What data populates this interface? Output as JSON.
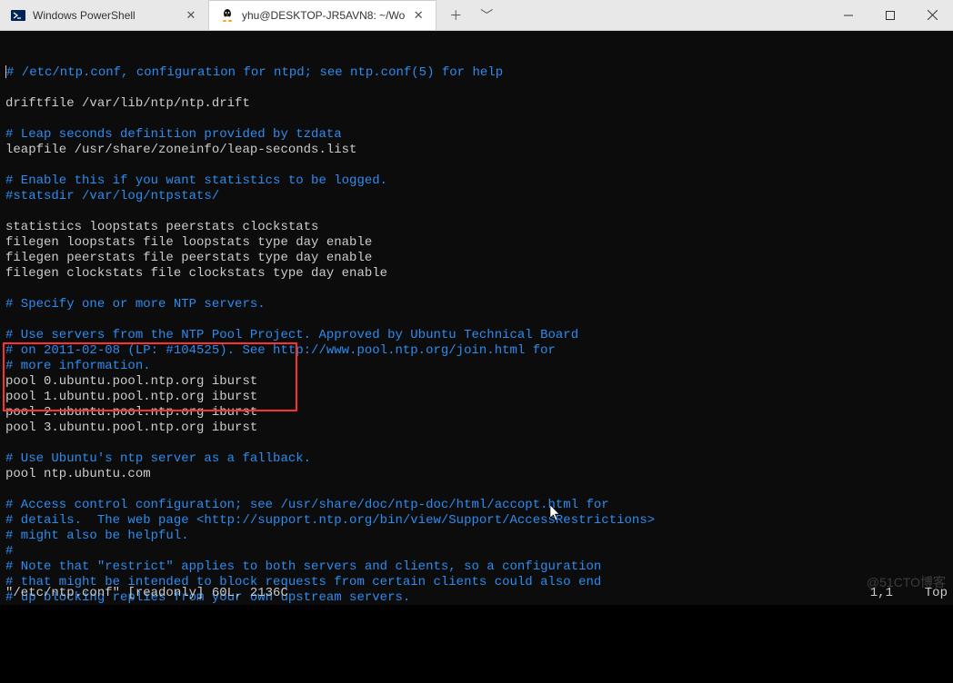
{
  "tabs": [
    {
      "title": "Windows PowerShell",
      "icon": "powershell"
    },
    {
      "title": "yhu@DESKTOP-JR5AVN8: ~/Wo",
      "icon": "tux"
    }
  ],
  "lines": [
    {
      "cls": "comment",
      "text": "# /etc/ntp.conf, configuration for ntpd; see ntp.conf(5) for help"
    },
    {
      "cls": "plain",
      "text": ""
    },
    {
      "cls": "plain",
      "text": "driftfile /var/lib/ntp/ntp.drift"
    },
    {
      "cls": "plain",
      "text": ""
    },
    {
      "cls": "comment",
      "text": "# Leap seconds definition provided by tzdata"
    },
    {
      "cls": "plain",
      "text": "leapfile /usr/share/zoneinfo/leap-seconds.list"
    },
    {
      "cls": "plain",
      "text": ""
    },
    {
      "cls": "comment",
      "text": "# Enable this if you want statistics to be logged."
    },
    {
      "cls": "comment",
      "text": "#statsdir /var/log/ntpstats/"
    },
    {
      "cls": "plain",
      "text": ""
    },
    {
      "cls": "plain",
      "text": "statistics loopstats peerstats clockstats"
    },
    {
      "cls": "plain",
      "text": "filegen loopstats file loopstats type day enable"
    },
    {
      "cls": "plain",
      "text": "filegen peerstats file peerstats type day enable"
    },
    {
      "cls": "plain",
      "text": "filegen clockstats file clockstats type day enable"
    },
    {
      "cls": "plain",
      "text": ""
    },
    {
      "cls": "comment",
      "text": "# Specify one or more NTP servers."
    },
    {
      "cls": "plain",
      "text": ""
    },
    {
      "cls": "comment",
      "text": "# Use servers from the NTP Pool Project. Approved by Ubuntu Technical Board"
    },
    {
      "cls": "comment",
      "text": "# on 2011-02-08 (LP: #104525). See http://www.pool.ntp.org/join.html for"
    },
    {
      "cls": "comment",
      "text": "# more information."
    },
    {
      "cls": "plain",
      "text": "pool 0.ubuntu.pool.ntp.org iburst"
    },
    {
      "cls": "plain",
      "text": "pool 1.ubuntu.pool.ntp.org iburst"
    },
    {
      "cls": "plain",
      "text": "pool 2.ubuntu.pool.ntp.org iburst"
    },
    {
      "cls": "plain",
      "text": "pool 3.ubuntu.pool.ntp.org iburst"
    },
    {
      "cls": "plain",
      "text": ""
    },
    {
      "cls": "comment",
      "text": "# Use Ubuntu's ntp server as a fallback."
    },
    {
      "cls": "plain",
      "text": "pool ntp.ubuntu.com"
    },
    {
      "cls": "plain",
      "text": ""
    },
    {
      "cls": "comment",
      "text": "# Access control configuration; see /usr/share/doc/ntp-doc/html/accopt.html for"
    },
    {
      "cls": "comment",
      "text": "# details.  The web page <http://support.ntp.org/bin/view/Support/AccessRestrictions>"
    },
    {
      "cls": "comment",
      "text": "# might also be helpful."
    },
    {
      "cls": "comment",
      "text": "#"
    },
    {
      "cls": "comment",
      "text": "# Note that \"restrict\" applies to both servers and clients, so a configuration"
    },
    {
      "cls": "comment",
      "text": "# that might be intended to block requests from certain clients could also end"
    },
    {
      "cls": "comment",
      "text": "# up blocking replies from your own upstream servers."
    }
  ],
  "status": {
    "file": "\"/etc/ntp.conf\" [readonly] 60L, 2136C",
    "pos": "1,1",
    "view": "Top"
  },
  "watermark": "@51CTO博客"
}
